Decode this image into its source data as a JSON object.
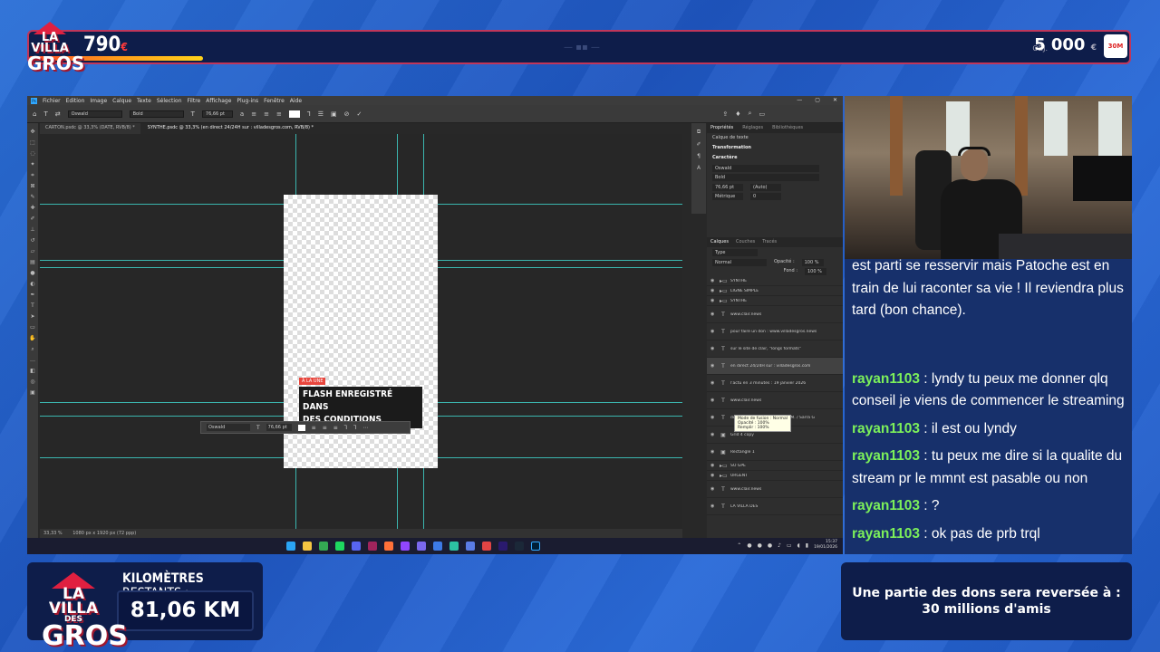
{
  "overlay": {
    "top_amount": "790",
    "top_currency": "€",
    "goal_label": "OBJ.",
    "goal_amount": "5 000",
    "goal_currency": "€",
    "progress_fraction": 0.158,
    "logo_line1": "LA VILLA",
    "logo_line2": "DES",
    "logo_line3": "GROS",
    "km_label_bold": "KILOMÈTRES",
    "km_label_rest": "RESTANTS :",
    "km_value": "81,06 KM",
    "info_line1": "Une partie des dons sera reversée à :",
    "info_line2": "30 millions d'amis"
  },
  "photoshop": {
    "menu": [
      "Fichier",
      "Edition",
      "Image",
      "Calque",
      "Texte",
      "Sélection",
      "Filtre",
      "Affichage",
      "Plug-ins",
      "Fenêtre",
      "Aide"
    ],
    "options_font": "Oswald",
    "options_style": "Bold",
    "options_size": "76,66 pt",
    "tabs": [
      {
        "label": "CARTON.psdc @ 33,3% (DATE, RVB/8) *"
      },
      {
        "label": "SYNTHE.psdc @ 33,3% (en direct 24/24H sur : villadesgros.com, RVB/8) *"
      }
    ],
    "artboard": {
      "tag": "À LA UNE",
      "title_line1": "FLASH ENREGISTRÉ DANS",
      "title_line2": "DES CONDITIONS"
    },
    "floating_bar": {
      "font": "Oswald",
      "size": "76,66 pt"
    },
    "status_zoom": "33,33 %",
    "status_doc": "1080 px x 1920 px (72 ppp)",
    "panel_tabs": [
      "Propriétés",
      "Réglages",
      "Bibliothèques"
    ],
    "panel_layer_type": "Calque de texte",
    "panel_transform": "Transformation",
    "panel_char": "Caractère",
    "panel_font": "Oswald",
    "panel_style": "Bold",
    "panel_size": "76,66 pt",
    "panel_leading": "(Auto)",
    "panel_kerning": "Métrique",
    "panel_tracking": "0",
    "layers_tabs": [
      "Calques",
      "Couches",
      "Tracés"
    ],
    "layers_kind": "Type",
    "blend_mode": "Normal",
    "opacity_label": "Opacité :",
    "opacity": "100 %",
    "fill_label": "Fond :",
    "fill": "100 %",
    "layers": [
      {
        "name": "SYNTHE",
        "type": "folder"
      },
      {
        "name": "LIGNE SIMPLE",
        "type": "folder"
      },
      {
        "name": "SYNTHE",
        "type": "folder"
      },
      {
        "name": "www.clair.news",
        "type": "text"
      },
      {
        "name": "pour faire un don : www.villadesgros.news",
        "type": "text"
      },
      {
        "name": "sur le site de clair, \"longs formats\"",
        "type": "text"
      },
      {
        "name": "en direct 24/24H sur : villadesgros.com",
        "type": "text"
      },
      {
        "name": "l'actu en 3 minutes : 19 janvier 2026",
        "type": "text"
      },
      {
        "name": "www.clair.news",
        "type": "text"
      },
      {
        "name": "donateurs JANVIER : ... Johan M. / Sarra G",
        "type": "text"
      },
      {
        "name": "Grid 4 copy",
        "type": "image"
      },
      {
        "name": "Rectangle 1",
        "type": "image"
      },
      {
        "name": "SO GPE",
        "type": "folder"
      },
      {
        "name": "URGENT",
        "type": "folder"
      },
      {
        "name": "www.clair.news",
        "type": "text"
      },
      {
        "name": "LA VILLA DES",
        "type": "text"
      }
    ],
    "tooltip_line1": "Mode de fusion : Normal",
    "tooltip_line2": "Opacité : 100%",
    "tooltip_line3": "Remplir : 100%",
    "clock_time": "15:37",
    "clock_date": "19/01/2026"
  },
  "chat": {
    "partial": "est parti se resservir mais Patoche est en train de lui raconter sa vie ! Il reviendra plus tard (bon chance).",
    "messages": [
      {
        "user": "rayan1103",
        "text": " : lyndy tu peux me donner qlq conseil je viens de commencer le streaming"
      },
      {
        "user": "rayan1103",
        "text": " : il est ou lyndy"
      },
      {
        "user": "rayan1103",
        "text": " : tu peux me dire si la qualite du stream pr le mmnt est pasable ou non"
      },
      {
        "user": "rayan1103",
        "text": " : ?"
      },
      {
        "user": "rayan1103",
        "text": " : ok pas de prb trql"
      }
    ]
  }
}
